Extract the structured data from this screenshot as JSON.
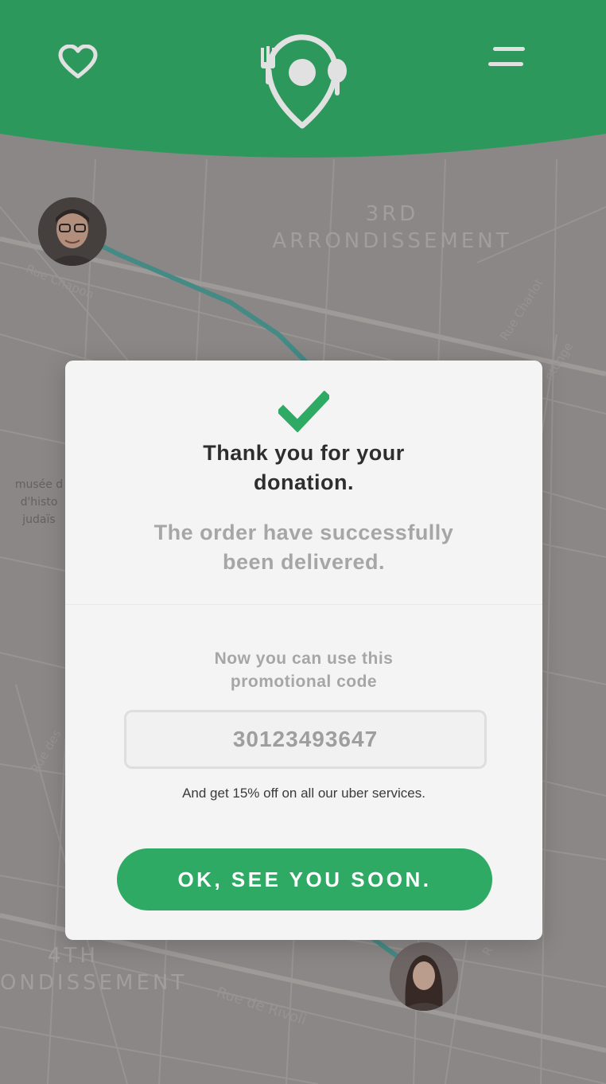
{
  "header": {
    "favorites_icon": "heart-icon",
    "logo_icon": "map-pin-fork-spoon-logo",
    "menu_icon": "menu-icon"
  },
  "map": {
    "districts": [
      "3RD",
      "ARRONDISSEMENT",
      "4TH",
      "ONDISSEMENT"
    ],
    "streets": [
      "Rue Chapon",
      "Rue Charlot",
      "ntonge",
      "Rue des",
      "Rue de Rivoli",
      "R"
    ],
    "poi": [
      "musée d",
      "d'histo",
      "judaïs"
    ]
  },
  "modal": {
    "title_line1": "Thank you for your",
    "title_line2": "donation.",
    "message_line1": "The order have successfully",
    "message_line2": "been delivered.",
    "promo_line1": "Now you can use this",
    "promo_line2": "promotional code",
    "promo_code": "30123493647",
    "discount_text": "And get 15% off on all our uber services.",
    "ok_button": "OK, SEE YOU SOON."
  },
  "colors": {
    "brand_green": "#2eaa65",
    "route": "#4a9a94",
    "map_bg": "#9a9796"
  }
}
